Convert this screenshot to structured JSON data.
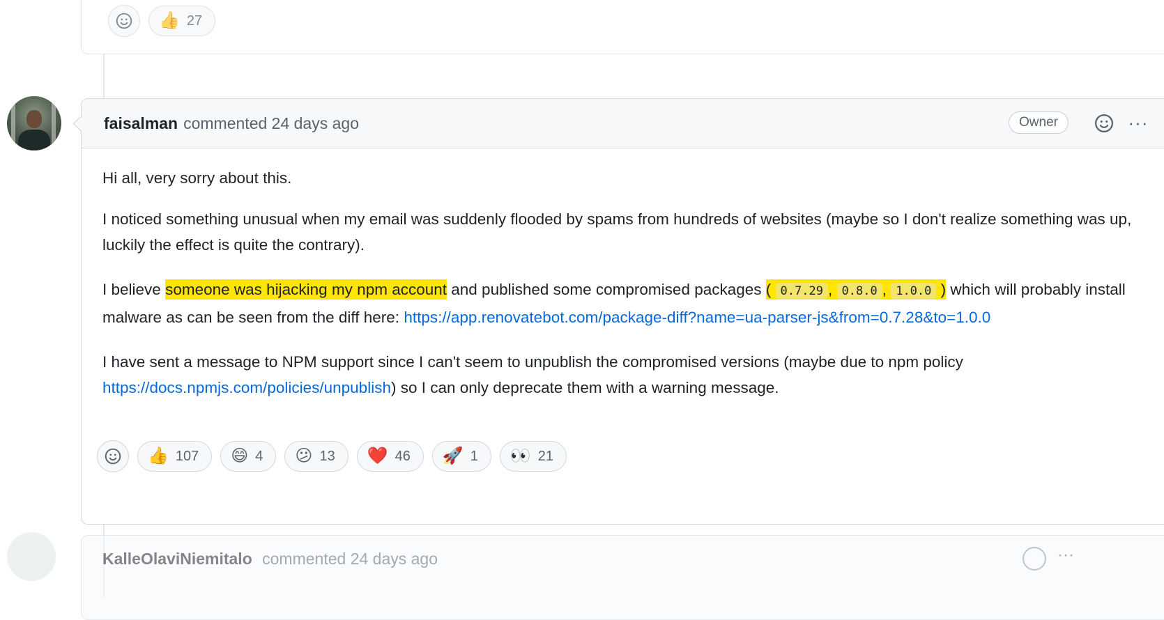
{
  "previous_comment": {
    "reactions": [
      {
        "emoji": "👍",
        "count": "27"
      }
    ]
  },
  "comment": {
    "author": "faisalman",
    "meta": "commented 24 days ago",
    "badge": "Owner",
    "body": {
      "p1": "Hi all, very sorry about this.",
      "p2": "I noticed something unusual when my email was suddenly flooded by spams from hundreds of websites (maybe so I don't realize something was up, luckily the effect is quite the contrary).",
      "p3_before": "I believe ",
      "p3_highlight": "someone was hijacking my npm account",
      "p3_mid": " and published some compromised packages ",
      "p3_open_paren": "(",
      "p3_versions": [
        "0.7.29",
        "0.8.0",
        "1.0.0"
      ],
      "p3_sep": ",",
      "p3_close_paren": ")",
      "p3_after": " which will probably install malware as can be seen from the diff here: ",
      "p3_link": "https://app.renovatebot.com/package-diff?name=ua-parser-js&from=0.7.28&to=1.0.0",
      "p4_before": "I have sent a message to NPM support since I can't seem to unpublish the compromised versions (maybe due to npm policy ",
      "p4_link": "https://docs.npmjs.com/policies/unpublish",
      "p4_after": ") so I can only deprecate them with a warning message."
    },
    "reactions": [
      {
        "name": "thumbs-up",
        "emoji": "👍",
        "count": "107"
      },
      {
        "name": "laugh",
        "emoji": "😄",
        "count": "4"
      },
      {
        "name": "confused",
        "emoji": "😕",
        "count": "13"
      },
      {
        "name": "heart",
        "emoji": "❤️",
        "count": "46"
      },
      {
        "name": "rocket",
        "emoji": "🚀",
        "count": "1"
      },
      {
        "name": "eyes",
        "emoji": "👀",
        "count": "21"
      }
    ]
  },
  "next_comment": {
    "author": "KalleOlaviNiemitalo",
    "meta": "commented 24 days ago"
  },
  "icons": {
    "add_reaction": "smiley-icon",
    "more": "kebab-horizontal-icon"
  },
  "colors": {
    "highlight": "#ffe600",
    "link": "#0969da",
    "border": "#d0d7de",
    "header_bg": "#f6f8fa"
  }
}
